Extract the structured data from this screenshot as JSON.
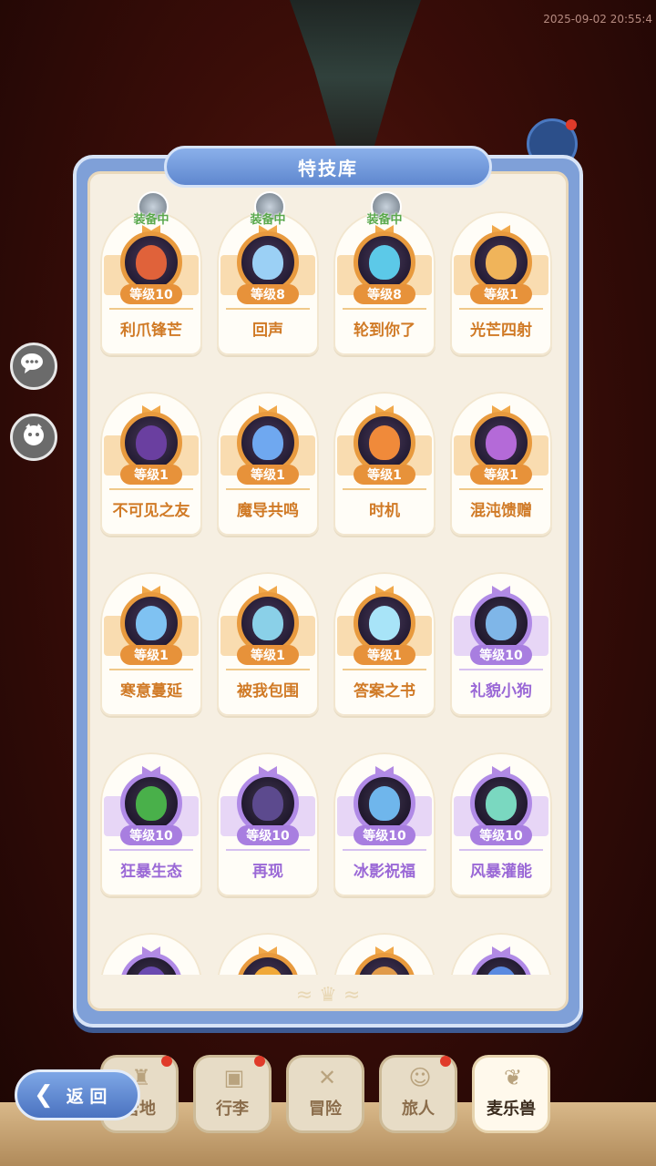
{
  "timestamp": "2025-09-02 20:55:4",
  "panel": {
    "title": "特技库"
  },
  "equipped_label": "装备中",
  "skills": [
    {
      "name": "利爪锋芒",
      "level": "等级10",
      "tier": "orange",
      "equipped": true,
      "pet_color": "#e0623a"
    },
    {
      "name": "回声",
      "level": "等级8",
      "tier": "orange",
      "equipped": true,
      "pet_color": "#9bd0f5"
    },
    {
      "name": "轮到你了",
      "level": "等级8",
      "tier": "orange",
      "equipped": true,
      "pet_color": "#5cc9e8"
    },
    {
      "name": "光芒四射",
      "level": "等级1",
      "tier": "orange",
      "equipped": false,
      "pet_color": "#f0b45a"
    },
    {
      "name": "不可见之友",
      "level": "等级1",
      "tier": "orange",
      "equipped": false,
      "pet_color": "#6a3fa0"
    },
    {
      "name": "魔导共鸣",
      "level": "等级1",
      "tier": "orange",
      "equipped": false,
      "pet_color": "#6fa8f0"
    },
    {
      "name": "时机",
      "level": "等级1",
      "tier": "orange",
      "equipped": false,
      "pet_color": "#f08a3a"
    },
    {
      "name": "混沌馈赠",
      "level": "等级1",
      "tier": "orange",
      "equipped": false,
      "pet_color": "#b46ad8"
    },
    {
      "name": "寒意蔓延",
      "level": "等级1",
      "tier": "orange",
      "equipped": false,
      "pet_color": "#7fc2f2"
    },
    {
      "name": "被我包围",
      "level": "等级1",
      "tier": "orange",
      "equipped": false,
      "pet_color": "#8ad0e8"
    },
    {
      "name": "答案之书",
      "level": "等级1",
      "tier": "orange",
      "equipped": false,
      "pet_color": "#a8e4f8"
    },
    {
      "name": "礼貌小狗",
      "level": "等级10",
      "tier": "purple",
      "equipped": false,
      "pet_color": "#7fb6e8"
    },
    {
      "name": "狂暴生态",
      "level": "等级10",
      "tier": "purple",
      "equipped": false,
      "pet_color": "#49b04a"
    },
    {
      "name": "再现",
      "level": "等级10",
      "tier": "purple",
      "equipped": false,
      "pet_color": "#5c4a8e"
    },
    {
      "name": "冰影祝福",
      "level": "等级10",
      "tier": "purple",
      "equipped": false,
      "pet_color": "#6fb6ec"
    },
    {
      "name": "风暴灌能",
      "level": "等级10",
      "tier": "purple",
      "equipped": false,
      "pet_color": "#7ad8c0"
    },
    {
      "name": "",
      "level": "",
      "tier": "purple",
      "equipped": false,
      "pet_color": "#6a4ab0"
    },
    {
      "name": "",
      "level": "",
      "tier": "orange",
      "equipped": false,
      "pet_color": "#f0a838"
    },
    {
      "name": "",
      "level": "",
      "tier": "orange",
      "equipped": false,
      "pet_color": "#e09a4a"
    },
    {
      "name": "",
      "level": "",
      "tier": "purple",
      "equipped": false,
      "pet_color": "#5a8ae0"
    }
  ],
  "nav": [
    {
      "label": "营地",
      "icon": "castle-icon",
      "badge": true
    },
    {
      "label": "行李",
      "icon": "chest-icon",
      "badge": true
    },
    {
      "label": "冒险",
      "icon": "swords-icon",
      "badge": false
    },
    {
      "label": "旅人",
      "icon": "character-icon",
      "badge": true
    },
    {
      "label": "麦乐兽",
      "icon": "pet-icon",
      "badge": false,
      "active": true
    }
  ],
  "back_button": {
    "label": "返 回"
  },
  "colors": {
    "orange_tier": "#e7923a",
    "purple_tier": "#a87ee0",
    "panel_blue": "#7fa0d8"
  }
}
